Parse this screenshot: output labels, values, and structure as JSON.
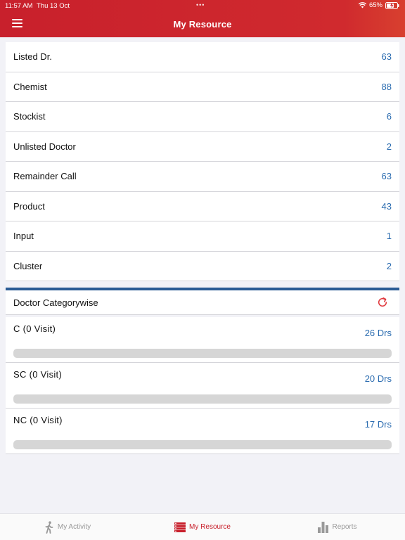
{
  "status": {
    "time": "11:57 AM",
    "date": "Thu 13 Oct",
    "dots": "•••",
    "battery": "65%"
  },
  "header": {
    "title": "My Resource"
  },
  "resources": [
    {
      "label": "Listed Dr.",
      "count": "63"
    },
    {
      "label": "Chemist",
      "count": "88"
    },
    {
      "label": "Stockist",
      "count": "6"
    },
    {
      "label": "Unlisted Doctor",
      "count": "2"
    },
    {
      "label": "Remainder Call",
      "count": "63"
    },
    {
      "label": "Product",
      "count": "43"
    },
    {
      "label": "Input",
      "count": "1"
    },
    {
      "label": "Cluster",
      "count": "2"
    }
  ],
  "category": {
    "title": "Doctor Categorywise",
    "items": [
      {
        "name": "C (0 Visit)",
        "count": "26 Drs",
        "progress": 0
      },
      {
        "name": "SC (0 Visit)",
        "count": "20 Drs",
        "progress": 0
      },
      {
        "name": "NC (0 Visit)",
        "count": "17 Drs",
        "progress": 0
      }
    ]
  },
  "tabs": [
    {
      "label": "My Activity",
      "icon": "walking-person-icon",
      "active": false
    },
    {
      "label": "My Resource",
      "icon": "list-icon",
      "active": true
    },
    {
      "label": "Reports",
      "icon": "bar-chart-icon",
      "active": false
    }
  ],
  "colors": {
    "brand": "#c8202c",
    "count": "#2b6cb0",
    "section_bar": "#2a5b94"
  }
}
